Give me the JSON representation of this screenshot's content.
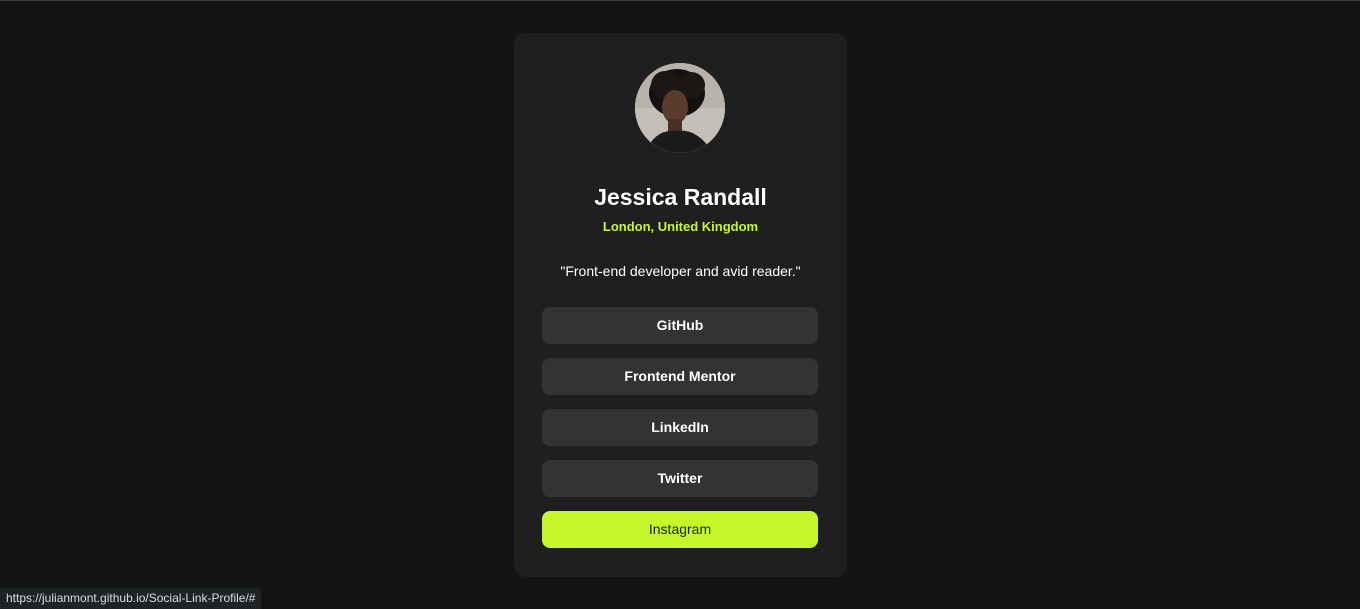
{
  "profile": {
    "name": "Jessica Randall",
    "location": "London, United Kingdom",
    "bio": "\"Front-end developer and avid reader.\""
  },
  "links": [
    {
      "label": "GitHub"
    },
    {
      "label": "Frontend Mentor"
    },
    {
      "label": "LinkedIn"
    },
    {
      "label": "Twitter"
    },
    {
      "label": "Instagram"
    }
  ],
  "status_bar": {
    "url": "https://julianmont.github.io/Social-Link-Profile/#"
  },
  "colors": {
    "background": "#141414",
    "card": "#1f1f1f",
    "accent": "#c4f82a",
    "button": "#333333"
  }
}
